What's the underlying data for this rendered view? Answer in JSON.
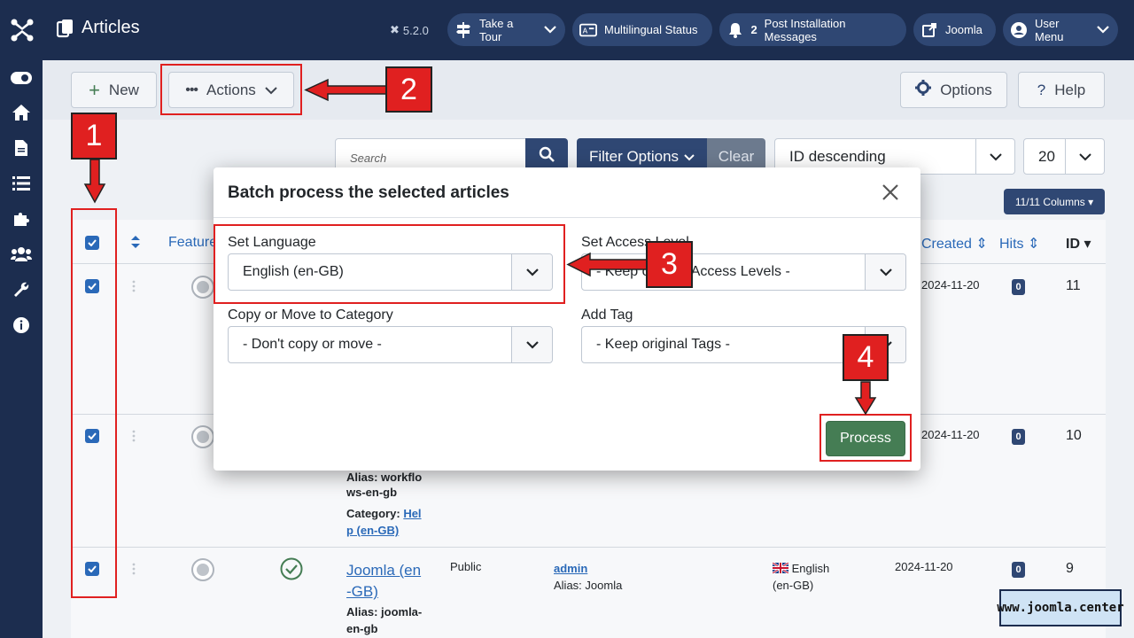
{
  "header": {
    "title": "Articles",
    "version": "5.2.0",
    "take_tour": "Take a Tour",
    "multilingual": "Multilingual Status",
    "post_install_count": "2",
    "post_install": "Post Installation Messages",
    "joomla": "Joomla",
    "user_menu": "User Menu"
  },
  "toolbar": {
    "new_label": "New",
    "actions_label": "Actions",
    "options_label": "Options",
    "help_label": "Help"
  },
  "filters": {
    "search_placeholder": "Search",
    "filter_options": "Filter Options",
    "clear": "Clear",
    "sort": "ID descending",
    "limit": "20",
    "columns": "11/11 Columns"
  },
  "table": {
    "headers": {
      "featured": "Featured",
      "created": "Created",
      "hits": "Hits",
      "id": "ID"
    },
    "rows": [
      {
        "date": "2024-11-20",
        "hits": "0",
        "id": "11"
      },
      {
        "date": "2024-11-20",
        "hits": "0",
        "id": "10",
        "alias_line1": "Alias: workflo",
        "alias_line2": "ws-en-gb",
        "category_label": "Category:",
        "category_link1": "Hel",
        "category_link2": "p (en-GB)"
      },
      {
        "title_line1": "Joomla (en",
        "title_line2": "-GB)",
        "alias_line1": "Alias: joomla-",
        "alias_line2": "en-gb",
        "access": "Public",
        "author": "admin",
        "author_alias": "Alias: Joomla",
        "lang1": "English",
        "lang2": "(en-GB)",
        "date": "2024-11-20",
        "hits": "0",
        "id": "9"
      }
    ]
  },
  "modal": {
    "title": "Batch process the selected articles",
    "set_language_label": "Set Language",
    "set_language_value": "English (en-GB)",
    "set_access_label": "Set Access Level",
    "set_access_value": "- Keep original Access Levels -",
    "copy_move_label": "Copy or Move to Category",
    "copy_move_value": "- Don't copy or move -",
    "add_tag_label": "Add Tag",
    "add_tag_value": "- Keep original Tags -",
    "process_label": "Process"
  },
  "annotations": {
    "n1": "1",
    "n2": "2",
    "n3": "3",
    "n4": "4",
    "color": "#e02020"
  },
  "watermark": "www.joomla.center",
  "colors": {
    "header_bg": "#1c2d4f",
    "primary": "#2f4773",
    "link": "#2a69b8",
    "success": "#457d54"
  }
}
